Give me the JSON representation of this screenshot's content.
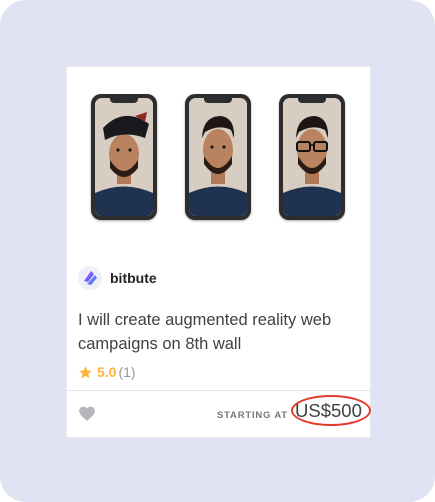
{
  "gig": {
    "seller_name": "bitbute",
    "title": "I will create augmented reality web campaigns on 8th wall",
    "rating": "5.0",
    "rating_count": "(1)",
    "starting_at_label": "STARTING AT",
    "price": "US$500"
  },
  "icons": {
    "favorite": "heart-icon",
    "rating": "star-icon",
    "seller": "seller-avatar"
  },
  "colors": {
    "background": "#dfe3f4",
    "rating_gold": "#ffb33e",
    "price_highlight": "#e23b2e",
    "title_text": "#404145"
  }
}
